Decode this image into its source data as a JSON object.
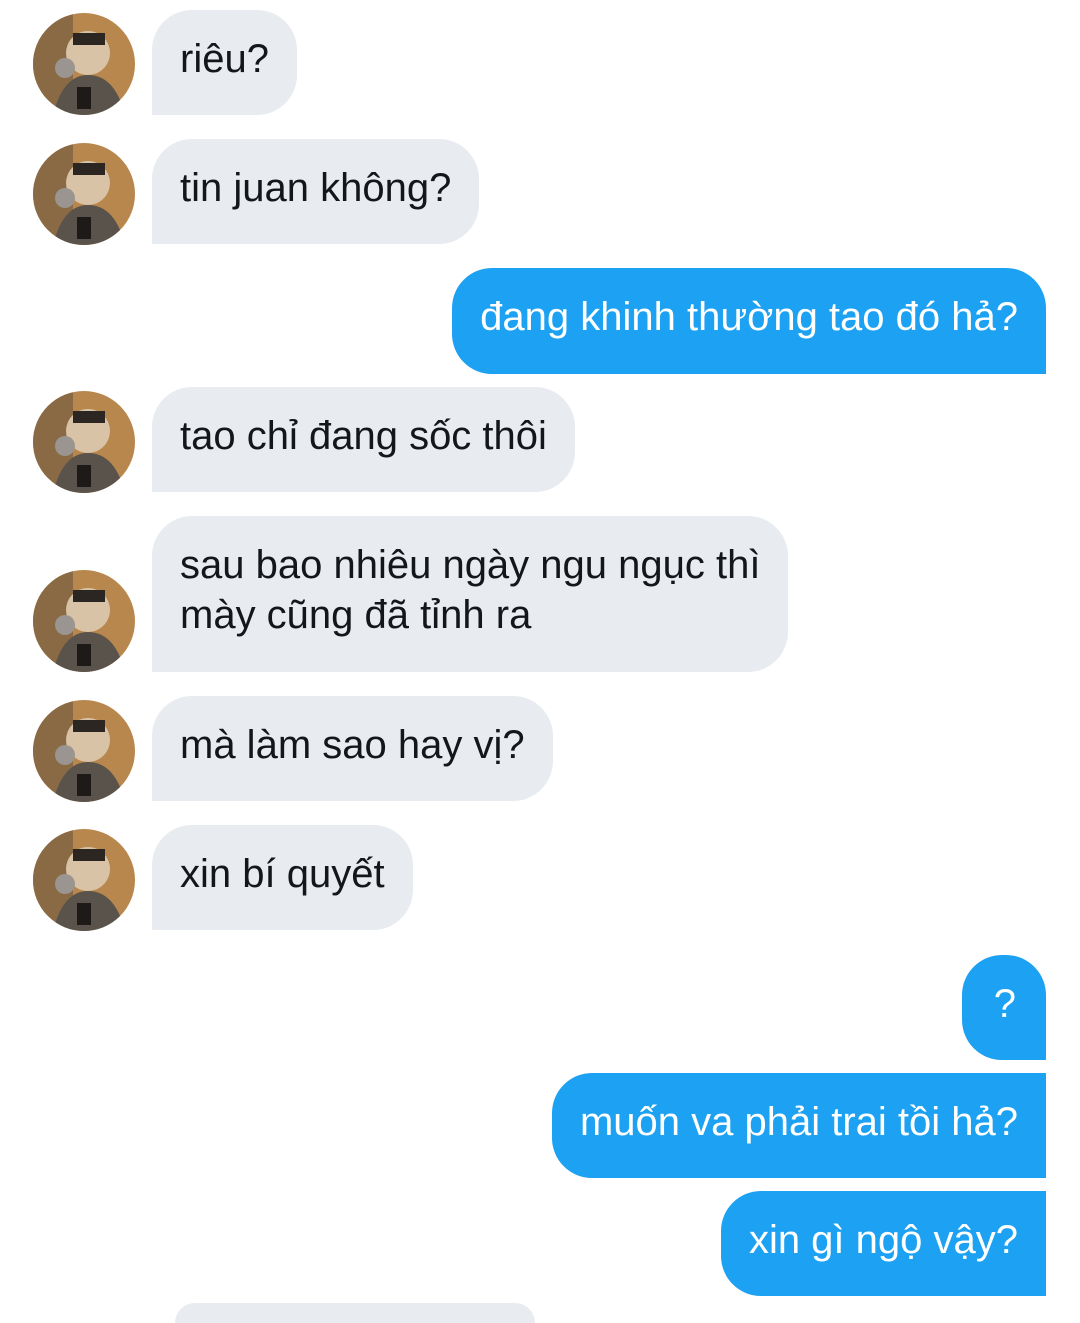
{
  "conversation": {
    "messages": [
      {
        "direction": "in",
        "text": "riêu?"
      },
      {
        "direction": "in",
        "text": "tin juan không?"
      },
      {
        "direction": "out",
        "text": "đang khinh thường tao đó hả?"
      },
      {
        "direction": "in",
        "text": "tao chỉ đang sốc thôi"
      },
      {
        "direction": "in",
        "text": "sau bao nhiêu ngày ngu ngục thì",
        "text2": "mày cũng đã tỉnh ra"
      },
      {
        "direction": "in",
        "text": "mà làm sao hay vị?"
      },
      {
        "direction": "in",
        "text": "xin bí quyết"
      },
      {
        "direction": "out",
        "text": "?"
      },
      {
        "direction": "out",
        "text": "muốn va phải trai tồi hả?"
      },
      {
        "direction": "out",
        "text": "xin gì ngộ vậy?"
      }
    ],
    "colors": {
      "incoming_bg": "#e8ebef",
      "outgoing_bg": "#1da1f2",
      "incoming_text": "#14171a",
      "outgoing_text": "#ffffff"
    },
    "avatar_icon": "user-avatar-photo"
  }
}
